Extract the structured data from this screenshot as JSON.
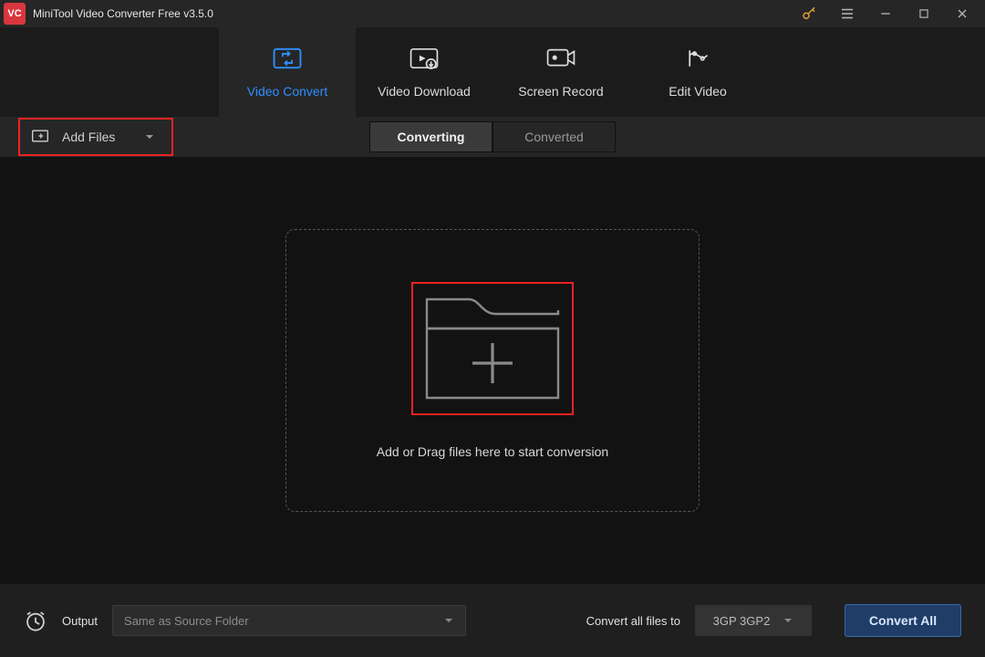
{
  "titlebar": {
    "title": "MiniTool Video Converter Free v3.5.0"
  },
  "main_tabs": [
    {
      "label": "Video Convert",
      "active": true
    },
    {
      "label": "Video Download",
      "active": false
    },
    {
      "label": "Screen Record",
      "active": false
    },
    {
      "label": "Edit Video",
      "active": false
    }
  ],
  "toolbar": {
    "add_files_label": "Add Files",
    "sub_tabs": [
      {
        "label": "Converting",
        "active": true
      },
      {
        "label": "Converted",
        "active": false
      }
    ]
  },
  "drop_area": {
    "instruction": "Add or Drag files here to start conversion"
  },
  "bottom_bar": {
    "output_label": "Output",
    "output_value": "Same as Source Folder",
    "convert_all_label": "Convert all files to",
    "format_value": "3GP 3GP2",
    "convert_button": "Convert All"
  },
  "colors": {
    "accent_blue": "#2f8fff",
    "highlight_red": "#e22222",
    "primary_button_bg": "#1f3d66"
  }
}
